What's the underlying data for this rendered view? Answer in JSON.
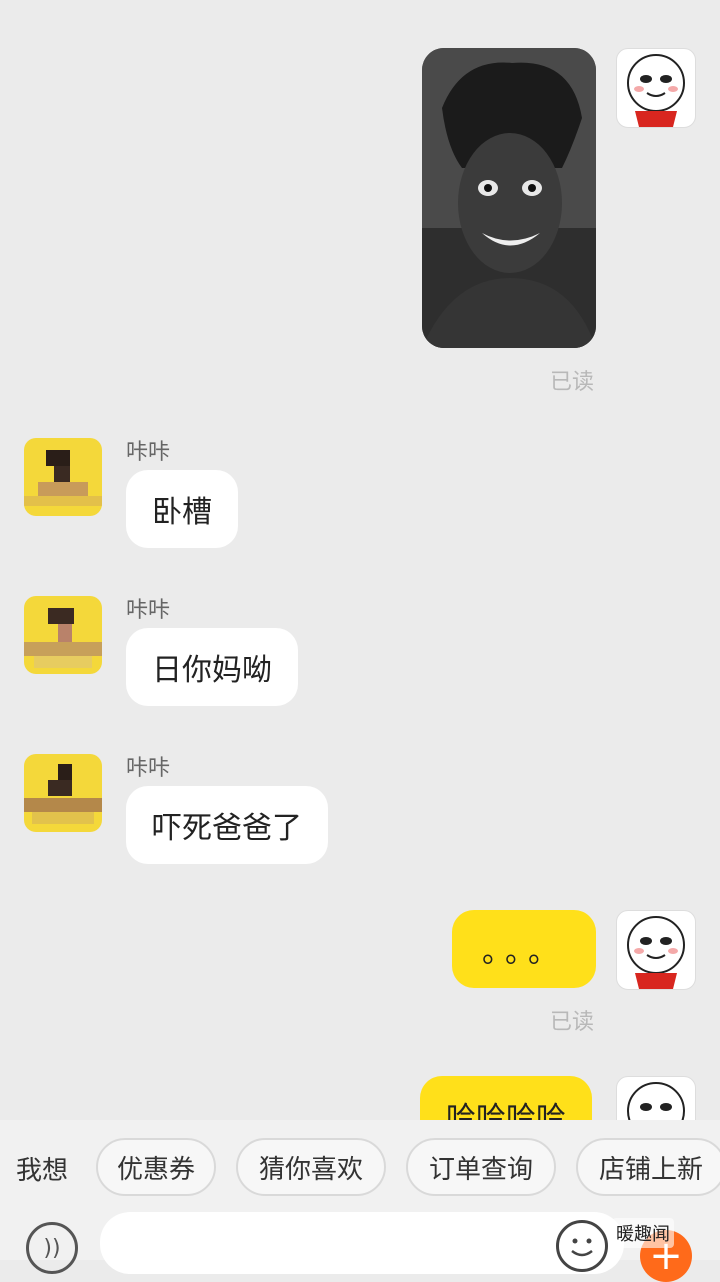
{
  "messages": [
    {
      "type": "image",
      "from": "me",
      "read": "已读"
    },
    {
      "type": "text",
      "from": "other",
      "sender": "咔咔",
      "text": "卧槽"
    },
    {
      "type": "text",
      "from": "other",
      "sender": "咔咔",
      "text": "日你妈呦"
    },
    {
      "type": "text",
      "from": "other",
      "sender": "咔咔",
      "text": "吓死爸爸了"
    },
    {
      "type": "text",
      "from": "me",
      "text": "。。。",
      "read": "已读"
    },
    {
      "type": "text",
      "from": "me",
      "text": "哈哈哈哈"
    }
  ],
  "quick_bar": {
    "label": "我想",
    "chips": [
      "优惠券",
      "猜你喜欢",
      "订单查询",
      "店铺上新"
    ]
  },
  "input": {
    "placeholder": ""
  },
  "watermark": "暖趣闻",
  "colors": {
    "my_bubble": "#ffe01a",
    "other_bubble": "#ffffff",
    "background": "#ebebeb",
    "plus_button": "#ff6a1a"
  },
  "icons": {
    "voice": "voice-icon",
    "emoji": "emoji-icon",
    "plus": "plus-icon",
    "watermark": "wechat-icon"
  }
}
